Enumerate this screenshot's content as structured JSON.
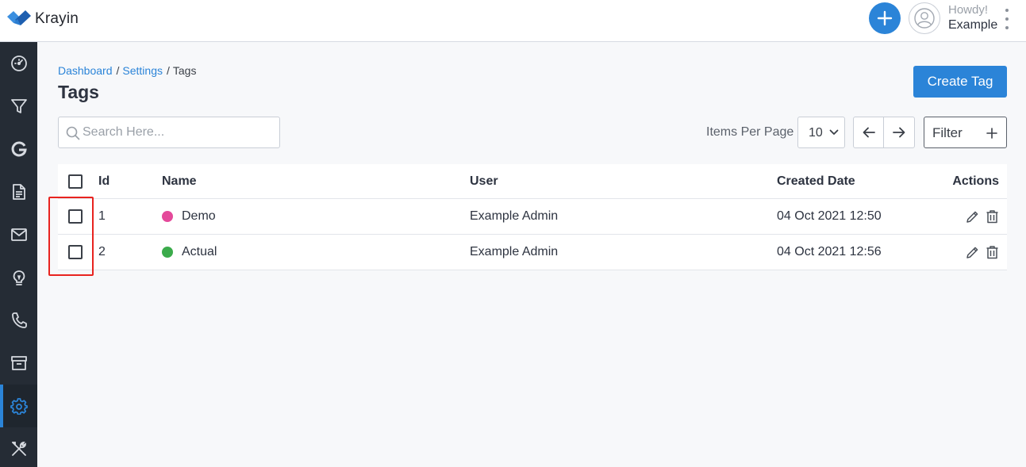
{
  "header": {
    "brand": "Krayin",
    "greeting": "Howdy!",
    "user_name": "Example",
    "add_icon": "plus-icon",
    "avatar_icon": "user-icon",
    "menu_icon": "kebab-menu-icon",
    "accent_color": "#2b84d8"
  },
  "sidebar": {
    "items": [
      {
        "name": "dashboard",
        "icon": "speedometer-icon"
      },
      {
        "name": "leads",
        "icon": "funnel-icon"
      },
      {
        "name": "google",
        "icon": "google-icon"
      },
      {
        "name": "quotes",
        "icon": "document-icon"
      },
      {
        "name": "mail",
        "icon": "mail-icon"
      },
      {
        "name": "activities",
        "icon": "lightbulb-icon"
      },
      {
        "name": "contacts",
        "icon": "phone-icon"
      },
      {
        "name": "products",
        "icon": "archive-icon"
      },
      {
        "name": "settings",
        "icon": "gear-icon",
        "active": true
      },
      {
        "name": "configuration",
        "icon": "tools-icon"
      }
    ]
  },
  "breadcrumb": {
    "dashboard": "Dashboard",
    "settings": "Settings",
    "current": "Tags",
    "sep": "/"
  },
  "page": {
    "title": "Tags",
    "create_label": "Create Tag"
  },
  "toolbar": {
    "search_placeholder": "Search Here...",
    "items_per_page_label": "Items Per Page",
    "items_per_page_value": "10",
    "filter_label": "Filter"
  },
  "table": {
    "columns": {
      "id": "Id",
      "name": "Name",
      "user": "User",
      "created": "Created Date",
      "actions": "Actions"
    },
    "rows": [
      {
        "id": "1",
        "name": "Demo",
        "color": "#e4499a",
        "user": "Example Admin",
        "created": "04 Oct 2021 12:50"
      },
      {
        "id": "2",
        "name": "Actual",
        "color": "#3bab4b",
        "user": "Example Admin",
        "created": "04 Oct 2021 12:56"
      }
    ]
  }
}
